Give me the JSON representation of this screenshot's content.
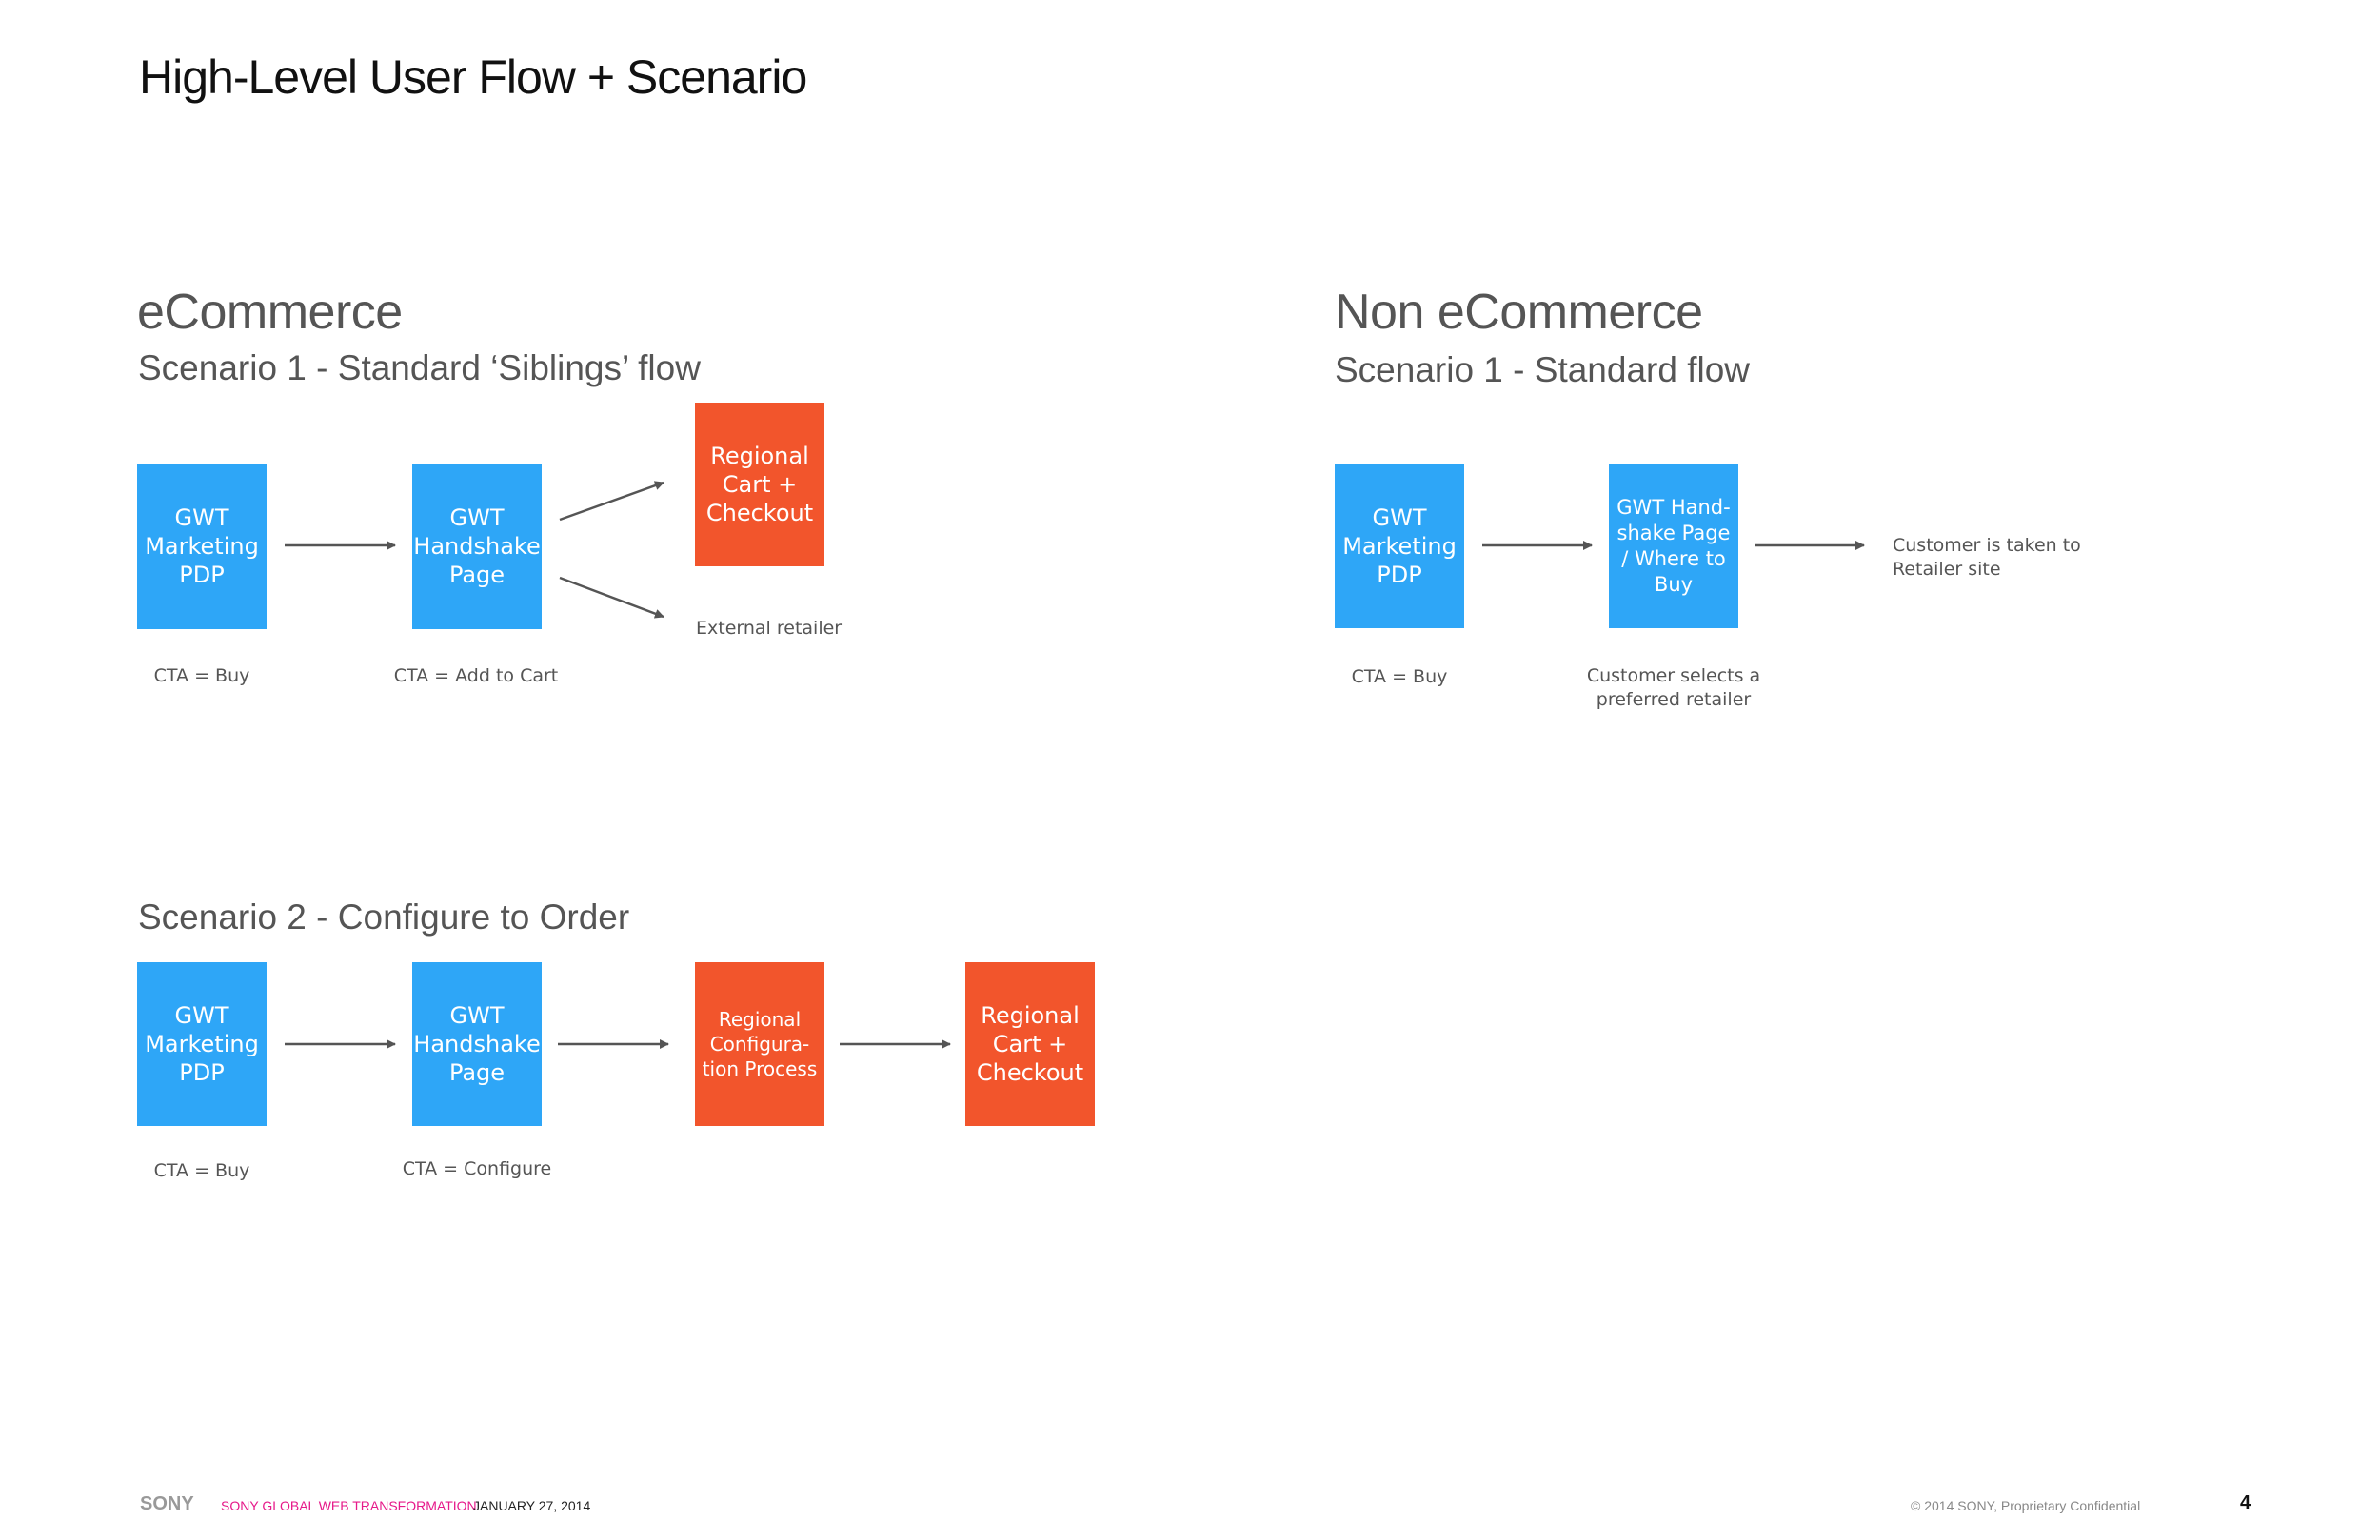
{
  "page": {
    "title": "High-Level User Flow + Scenario",
    "colors": {
      "blue": "#2ea6f7",
      "orange": "#f2552c",
      "accent_pink": "#e6198a",
      "arrow": "#555555"
    }
  },
  "ecommerce": {
    "heading": "eCommerce",
    "scenario1": {
      "title": "Scenario 1 - Standard ‘Siblings’ flow",
      "nodes": [
        {
          "lines": [
            "GWT",
            "Marketing",
            "PDP"
          ],
          "color": "blue",
          "caption": "CTA = Buy"
        },
        {
          "lines": [
            "GWT",
            "Handshake",
            "Page"
          ],
          "color": "blue",
          "caption": "CTA = Add to Cart"
        },
        {
          "lines": [
            "Regional",
            "Cart +",
            "Checkout"
          ],
          "color": "orange"
        }
      ],
      "external_label": "External retailer"
    },
    "scenario2": {
      "title": "Scenario 2 - Configure to Order",
      "nodes": [
        {
          "lines": [
            "GWT",
            "Marketing",
            "PDP"
          ],
          "color": "blue",
          "caption": "CTA = Buy"
        },
        {
          "lines": [
            "GWT",
            "Handshake",
            "Page"
          ],
          "color": "blue",
          "caption": "CTA = Configure"
        },
        {
          "lines": [
            "Regional",
            "Configura-",
            "tion Process"
          ],
          "color": "orange"
        },
        {
          "lines": [
            "Regional",
            "Cart +",
            "Checkout"
          ],
          "color": "orange"
        }
      ]
    }
  },
  "non_ecommerce": {
    "heading": "Non eCommerce",
    "scenario1": {
      "title": "Scenario 1 - Standard flow",
      "nodes": [
        {
          "lines": [
            "GWT",
            "Marketing",
            "PDP"
          ],
          "color": "blue",
          "caption": "CTA = Buy"
        },
        {
          "lines": [
            "GWT Hand-",
            "shake Page",
            "/ Where to",
            "Buy"
          ],
          "color": "blue",
          "caption_lines": [
            "Customer selects a",
            "preferred retailer"
          ]
        }
      ],
      "end_note_lines": [
        "Customer is taken to",
        "Retailer site"
      ]
    }
  },
  "footer": {
    "logo": "SONY",
    "project": "SONY GLOBAL WEB TRANSFORMATION",
    "date": "JANUARY 27, 2014",
    "copyright": "© 2014 SONY, Proprietary  Confidential",
    "page_number": "4"
  }
}
